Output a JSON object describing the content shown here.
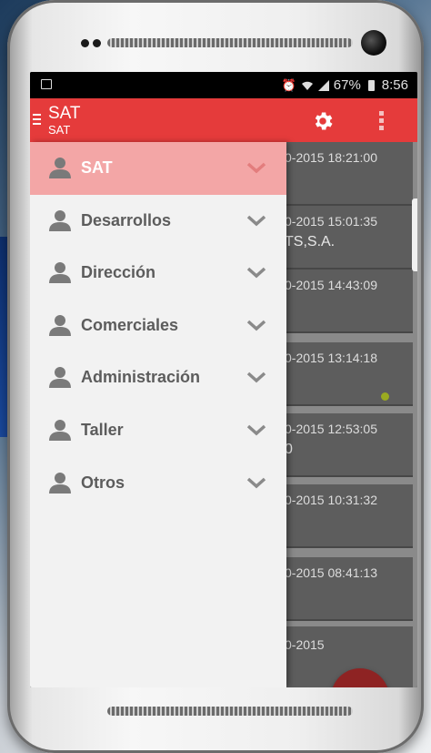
{
  "status_bar": {
    "battery_percent": "67%",
    "time": "8:56",
    "icons": [
      "alarm-icon",
      "wifi-icon",
      "signal-icon"
    ]
  },
  "app_bar": {
    "title": "SAT",
    "subtitle": "SAT",
    "accent_color": "#e53b3b"
  },
  "drawer": {
    "items": [
      {
        "label": "SAT",
        "active": true
      },
      {
        "label": "Desarrollos",
        "active": false
      },
      {
        "label": "Dirección",
        "active": false
      },
      {
        "label": "Comerciales",
        "active": false
      },
      {
        "label": "Administración",
        "active": false
      },
      {
        "label": "Taller",
        "active": false
      },
      {
        "label": "Otros",
        "active": false
      }
    ],
    "active_color": "#f3a6a6"
  },
  "list": {
    "cards": [
      {
        "time": "0-2015 18:21:00",
        "company": ""
      },
      {
        "time": "0-2015 15:01:35",
        "company": "TS,S.A."
      },
      {
        "time": "0-2015 14:43:09",
        "company": ""
      },
      {
        "time": "0-2015 13:14:18",
        "company": "",
        "dot": true
      },
      {
        "time": "0-2015 12:53:05",
        "company": "0"
      },
      {
        "time": "0-2015 10:31:32",
        "company": ""
      },
      {
        "time": "0-2015 08:41:13",
        "company": ""
      },
      {
        "time": "0-2015",
        "company": ""
      }
    ]
  },
  "fab": {
    "label": "+"
  }
}
